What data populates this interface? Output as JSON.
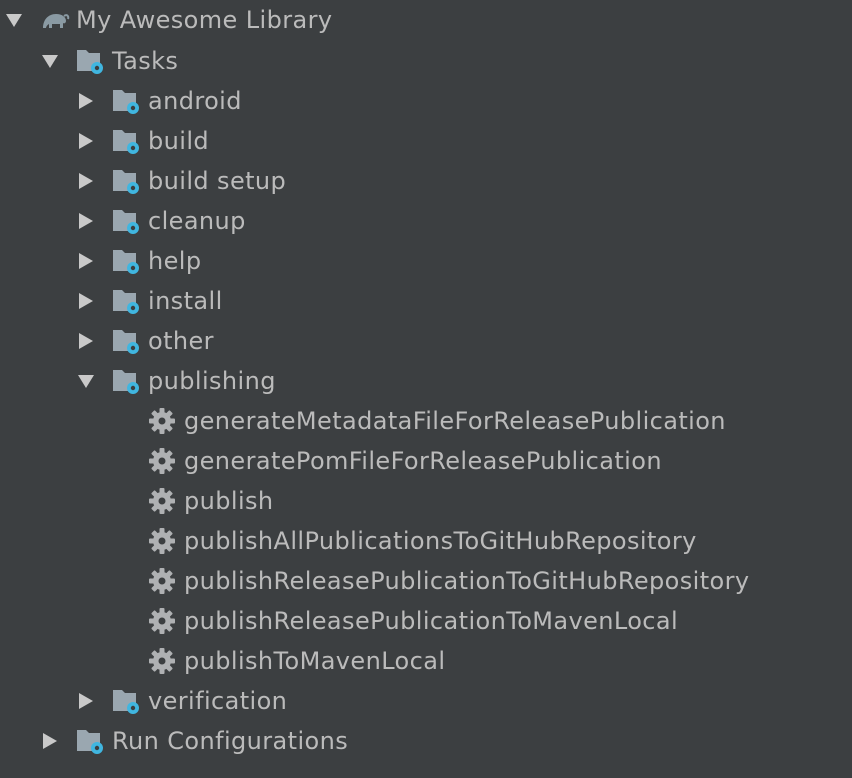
{
  "tree": {
    "root": {
      "label": "My Awesome Library",
      "expanded": true,
      "icon": "gradle-elephant-icon"
    },
    "tasks": {
      "label": "Tasks",
      "expanded": true,
      "icon": "task-folder-icon"
    },
    "task_groups": [
      {
        "label": "android",
        "expanded": false
      },
      {
        "label": "build",
        "expanded": false
      },
      {
        "label": "build setup",
        "expanded": false
      },
      {
        "label": "cleanup",
        "expanded": false
      },
      {
        "label": "help",
        "expanded": false
      },
      {
        "label": "install",
        "expanded": false
      },
      {
        "label": "other",
        "expanded": false
      },
      {
        "label": "publishing",
        "expanded": true
      },
      {
        "label": "verification",
        "expanded": false
      }
    ],
    "publishing_tasks": [
      "generateMetadataFileForReleasePublication",
      "generatePomFileForReleasePublication",
      "publish",
      "publishAllPublicationsToGitHubRepository",
      "publishReleasePublicationToGitHubRepository",
      "publishReleasePublicationToMavenLocal",
      "publishToMavenLocal"
    ],
    "run_configurations": {
      "label": "Run Configurations",
      "expanded": false
    }
  },
  "colors": {
    "background": "#3c3f41",
    "text": "#bbbbbb",
    "folder": "#9aa7b0",
    "gear_badge": "#40b6e0",
    "task_gear": "#afb1b3",
    "arrow": "#c9c9c9"
  }
}
